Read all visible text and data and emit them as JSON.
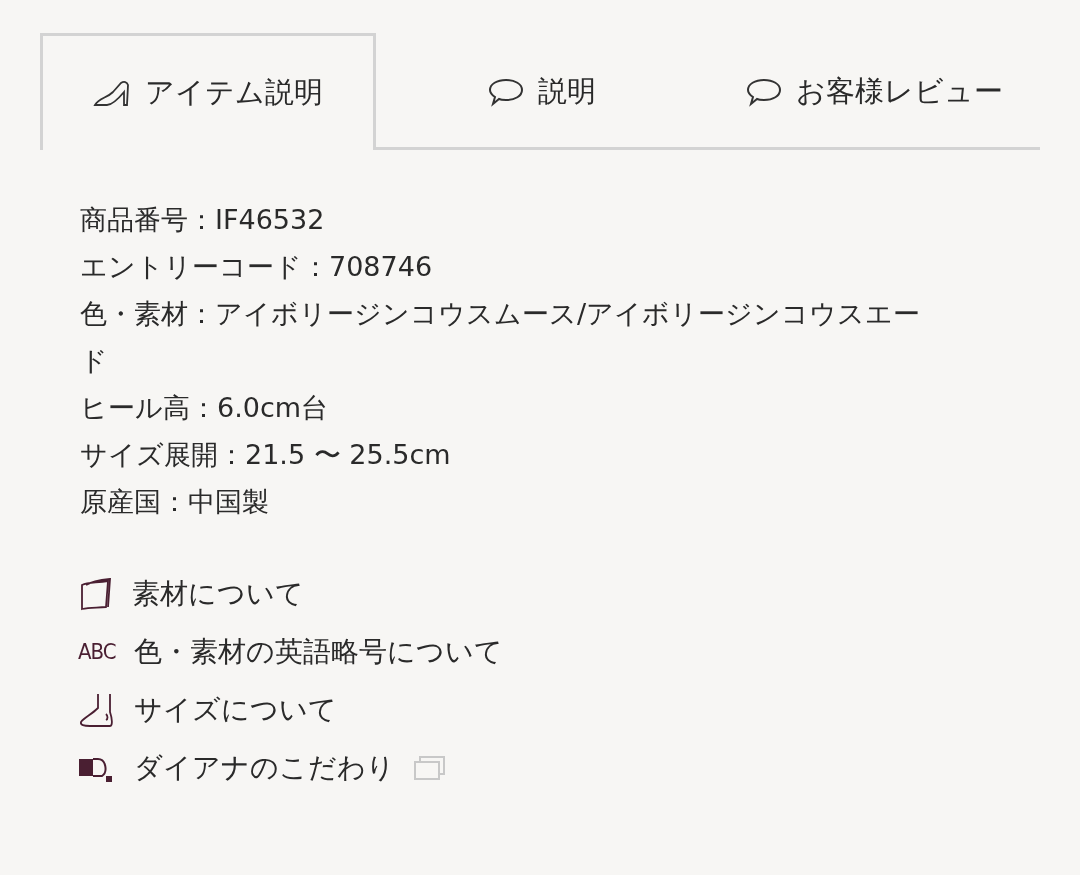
{
  "tabs": [
    {
      "label": "アイテム説明",
      "kind": "shoe",
      "selected": true
    },
    {
      "label": "説明",
      "kind": "speech",
      "selected": false
    },
    {
      "label": "お客様レビュー",
      "kind": "speech",
      "selected": false
    }
  ],
  "specs": [
    "商品番号：IF46532",
    "エントリーコード：708746",
    "色・素材：アイボリージンコウスムース/アイボリージンコウスエード",
    "ヒール高：6.0cm台",
    "サイズ展開：21.5 〜 25.5cm",
    "原産国：中国製"
  ],
  "links": [
    {
      "kind": "fabric",
      "label": "素材について",
      "external": false
    },
    {
      "kind": "letters",
      "badge": "ABC",
      "label": "色・素材の英語略号について",
      "external": false
    },
    {
      "kind": "foot",
      "label": "サイズについて",
      "external": false
    },
    {
      "kind": "brand",
      "label": "ダイアナのこだわり",
      "external": true
    }
  ]
}
